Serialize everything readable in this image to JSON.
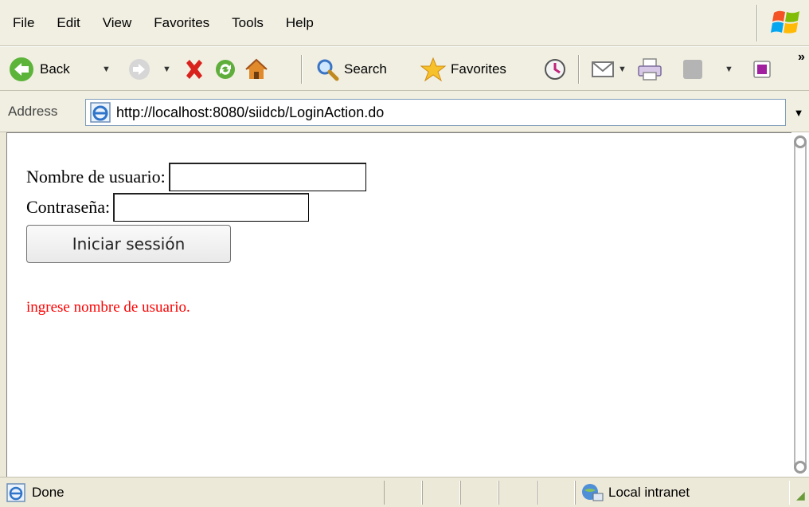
{
  "menu": [
    "File",
    "Edit",
    "View",
    "Favorites",
    "Tools",
    "Help"
  ],
  "toolbar": {
    "back_label": "Back",
    "search_label": "Search",
    "favorites_label": "Favorites",
    "more_chevron": "»"
  },
  "address": {
    "label": "Address",
    "url": "http://localhost:8080/siidcb/LoginAction.do"
  },
  "form": {
    "username_label": "Nombre de usuario:",
    "username_value": "",
    "password_label": "Contraseña:",
    "password_value": "",
    "submit_label": "Iniciar sessión"
  },
  "error_message": "ingrese nombre de usuario.",
  "status": {
    "text": "Done",
    "zone": "Local intranet"
  },
  "colors": {
    "error": "#ff0000",
    "chrome": "#ece9d8"
  }
}
